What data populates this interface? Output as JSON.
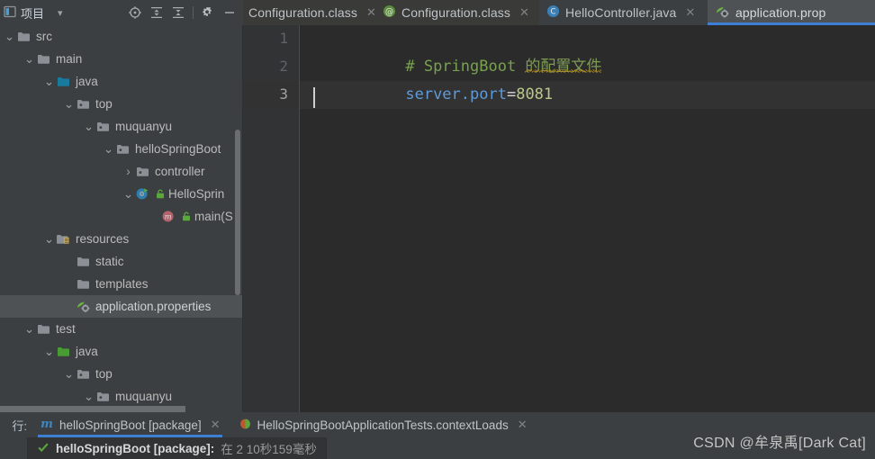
{
  "tool_window": {
    "title": "项目",
    "icons": [
      {
        "name": "project-dropdown-icon",
        "glyph": "▾"
      },
      {
        "name": "locate-icon",
        "glyph": "locate"
      },
      {
        "name": "expand-all-icon",
        "glyph": "expand"
      },
      {
        "name": "collapse-all-icon",
        "glyph": "collapse"
      },
      {
        "name": "settings-gear-icon",
        "glyph": "gear"
      },
      {
        "name": "hide-icon",
        "glyph": "minus"
      }
    ]
  },
  "editor_tabs": [
    {
      "label": "Configuration.class",
      "icon": "class-file-icon",
      "active": false,
      "close": "✕"
    },
    {
      "label": "Configuration.class",
      "icon": "annotation-icon",
      "active": false,
      "close": "✕"
    },
    {
      "label": "HelloController.java",
      "icon": "java-class-icon",
      "active": false,
      "close": "✕"
    },
    {
      "label": "application.prop",
      "icon": "spring-properties-icon",
      "active": true,
      "close": ""
    }
  ],
  "tree": [
    {
      "label": "src",
      "depth": 0,
      "arrow": "v",
      "icon": "folder-grey",
      "selected": false
    },
    {
      "label": "main",
      "depth": 1,
      "arrow": "v",
      "icon": "folder-grey",
      "selected": false
    },
    {
      "label": "java",
      "depth": 2,
      "arrow": "v",
      "icon": "folder-teal",
      "selected": false
    },
    {
      "label": "top",
      "depth": 3,
      "arrow": "v",
      "icon": "package",
      "selected": false
    },
    {
      "label": "muquanyu",
      "depth": 4,
      "arrow": "v",
      "icon": "package",
      "selected": false
    },
    {
      "label": "helloSpringBoot",
      "depth": 5,
      "arrow": "v",
      "icon": "package",
      "selected": false
    },
    {
      "label": "controller",
      "depth": 6,
      "arrow": ">",
      "icon": "package",
      "selected": false
    },
    {
      "label": "HelloSprin",
      "depth": 6,
      "arrow": "v",
      "icon": "spring-class",
      "lock": true,
      "selected": false
    },
    {
      "label": "main(S",
      "depth": 7,
      "arrow": "",
      "icon": "method",
      "lock": true,
      "selected": false
    },
    {
      "label": "resources",
      "depth": 2,
      "arrow": "v",
      "icon": "folder-res",
      "selected": false
    },
    {
      "label": "static",
      "depth": 3,
      "arrow": "",
      "icon": "folder-grey",
      "selected": false
    },
    {
      "label": "templates",
      "depth": 3,
      "arrow": "",
      "icon": "folder-grey",
      "selected": false
    },
    {
      "label": "application.properties",
      "depth": 3,
      "arrow": "",
      "icon": "spring-leaf",
      "selected": true
    },
    {
      "label": "test",
      "depth": 1,
      "arrow": "v",
      "icon": "folder-grey",
      "selected": false
    },
    {
      "label": "java",
      "depth": 2,
      "arrow": "v",
      "icon": "folder-green",
      "selected": false
    },
    {
      "label": "top",
      "depth": 3,
      "arrow": "v",
      "icon": "package",
      "selected": false
    },
    {
      "label": "muquanyu",
      "depth": 4,
      "arrow": "v",
      "icon": "package",
      "selected": false
    }
  ],
  "editor": {
    "line_numbers": [
      "1",
      "2",
      "3"
    ],
    "current_line": 3,
    "line1": {
      "comment": "# SpringBoot ",
      "chinese": "的配置文件"
    },
    "line2": {
      "key": "server.port",
      "eq": "=",
      "value": "8081"
    }
  },
  "run_panel": {
    "left_label": "行:",
    "tabs": [
      {
        "label": "helloSpringBoot [package]",
        "icon": "maven-m-icon",
        "active": true,
        "close": "✕"
      },
      {
        "label": "HelloSpringBootApplicationTests.contextLoads",
        "icon": "test-run-icon",
        "active": false,
        "close": "✕"
      }
    ],
    "result": {
      "status_icon": "green-check-icon",
      "title": "helloSpringBoot [package]:",
      "detail": "在 2 10秒159毫秒"
    }
  },
  "watermark": "CSDN @牟泉禹[Dark Cat]",
  "colors": {
    "accent": "#3c7fd4",
    "panel": "#3c3f41",
    "editor_bg": "#2b2b2b",
    "gutter_bg": "#313335",
    "comment": "#78a14f",
    "key": "#5e9bd8",
    "value": "#bcc88a",
    "squiggle": "#b8860b",
    "selection": "#4e5254"
  }
}
